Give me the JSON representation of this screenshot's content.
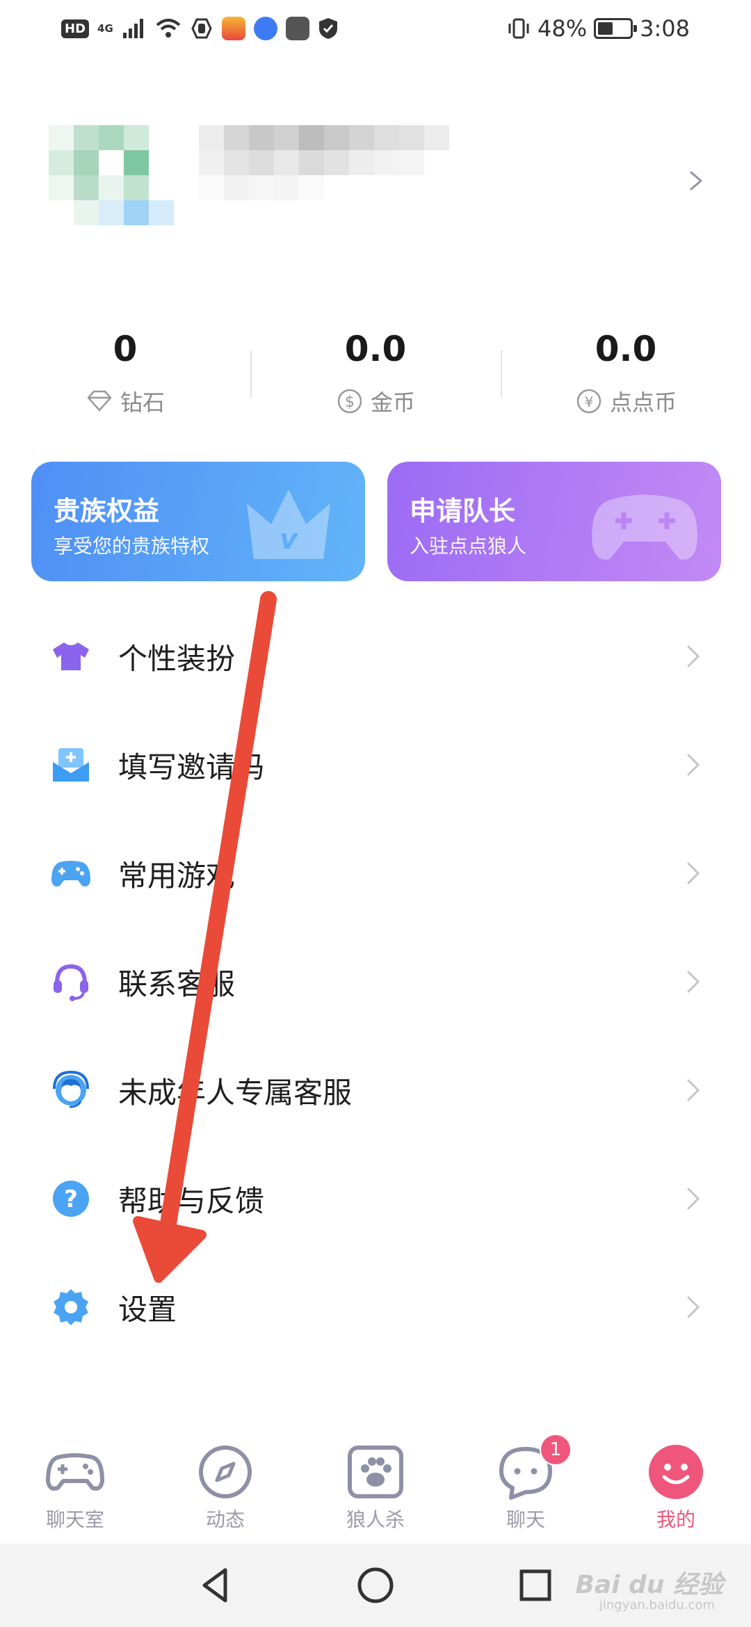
{
  "status_bar": {
    "hd": "HD",
    "network": "4G",
    "battery_text": "48%",
    "battery_level": 0.48,
    "time": "3:08"
  },
  "profile": {
    "arrow_icon": "chevron-right-icon"
  },
  "stats": [
    {
      "value": "0",
      "label": "钻石",
      "icon": "diamond-icon"
    },
    {
      "value": "0.0",
      "label": "金币",
      "icon": "dollar-coin-icon"
    },
    {
      "value": "0.0",
      "label": "点点币",
      "icon": "yuan-coin-icon"
    }
  ],
  "cards": {
    "noble": {
      "title": "贵族权益",
      "subtitle": "享受您的贵族特权",
      "icon": "crown-icon"
    },
    "captain": {
      "title": "申请队长",
      "subtitle": "入驻点点狼人",
      "icon": "gamepad-icon"
    }
  },
  "menu": [
    {
      "label": "个性装扮",
      "icon": "tshirt-icon",
      "color": "#8b63ec"
    },
    {
      "label": "填写邀请码",
      "icon": "invite-envelope-icon",
      "color": "#4aa3f3"
    },
    {
      "label": "常用游戏",
      "icon": "gamepad-icon",
      "color": "#4aa3f3"
    },
    {
      "label": "联系客服",
      "icon": "headset-icon",
      "color": "#8b63ec"
    },
    {
      "label": "未成年人专属客服",
      "icon": "support-agent-icon",
      "color": "#4aa3f3"
    },
    {
      "label": "帮助与反馈",
      "icon": "help-icon",
      "color": "#4aa3f3"
    },
    {
      "label": "设置",
      "icon": "settings-gear-icon",
      "color": "#4aa3f3"
    }
  ],
  "tabs": [
    {
      "label": "聊天室",
      "icon": "gamepad-outline-icon",
      "active": false
    },
    {
      "label": "动态",
      "icon": "compass-icon",
      "active": false
    },
    {
      "label": "狼人杀",
      "icon": "paw-icon",
      "active": false
    },
    {
      "label": "聊天",
      "icon": "chat-bubble-icon",
      "active": false,
      "badge": "1"
    },
    {
      "label": "我的",
      "icon": "smiley-icon",
      "active": true
    }
  ],
  "colors": {
    "accent": "#f0567c",
    "tab_inactive": "#9a9ba8",
    "annotation_arrow": "#ea4a38"
  },
  "watermark": {
    "text": "Bai du 经验",
    "sub": "jingyan.baidu.com"
  }
}
